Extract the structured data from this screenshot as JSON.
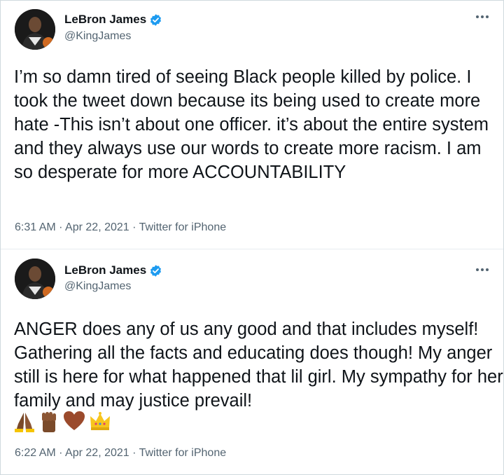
{
  "tweets": [
    {
      "display_name": "LeBron James",
      "handle": "@KingJames",
      "text": "I’m so damn tired of seeing Black people killed by police. I took the tweet down because its being used to create more hate -This isn’t about one officer.  it’s about the entire system and they always use our words to create more racism. I am so desperate for more ACCOUNTABILITY",
      "time": "6:31 AM",
      "date": "Apr 22, 2021",
      "source": "Twitter for iPhone",
      "separator": "·"
    },
    {
      "display_name": "LeBron James",
      "handle": "@KingJames",
      "text": "ANGER does any of us any good and that includes myself! Gathering all the facts and educating does though! My anger still is here for what happened that lil girl. My sympathy for her family and may justice prevail!",
      "emojis": [
        "folded-hands-icon",
        "raised-fist-icon",
        "brown-heart-icon",
        "crown-icon"
      ],
      "time": "6:22 AM",
      "date": "Apr 22, 2021",
      "source": "Twitter for iPhone",
      "separator": "·"
    }
  ],
  "colors": {
    "verified": "#1d9bf0",
    "secondary_text": "#536471",
    "primary_text": "#0f1419",
    "divider": "#e6ecf0"
  }
}
